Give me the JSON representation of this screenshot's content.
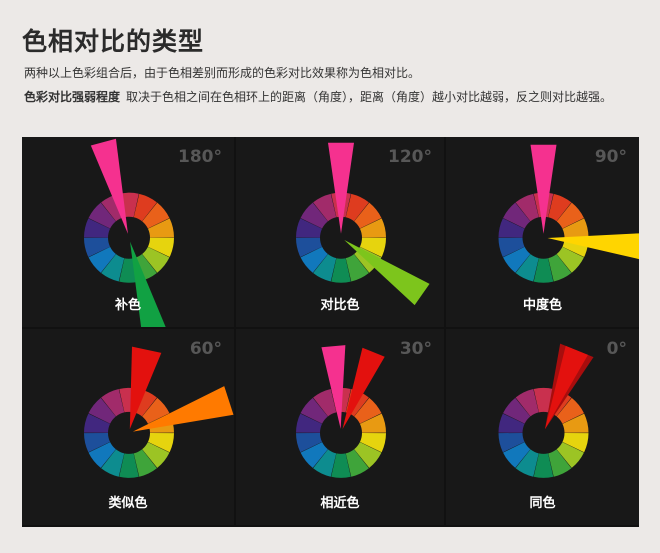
{
  "header": {
    "title": "色相对比的类型",
    "line1": "两种以上色彩组合后，由于色相差别而形成的色彩对比效果称为色相对比。",
    "line2_bold": "色彩对比强弱程度",
    "line2_rest": "取决于色相之间在色相环上的距离（角度），距离（角度）越小对比越弱，反之则对比越强。"
  },
  "colors": {
    "ring": [
      "#c9304e",
      "#de3c1f",
      "#e9611a",
      "#e89a12",
      "#e6d40e",
      "#9cc424",
      "#3fa43a",
      "#0f8c54",
      "#0d8c8f",
      "#1178bc",
      "#1d4f9b",
      "#41277f",
      "#71277a",
      "#a12b6a"
    ],
    "pointer_magenta": "#f5318f",
    "pointer_green": "#11a143",
    "pointer_lime": "#7dc51c",
    "pointer_yellow": "#ffd500",
    "pointer_red": "#e3110e",
    "pointer_orange": "#ff7a00",
    "pointer_crimson": "#f01b40",
    "pointer_darkred": "#a80d0d"
  },
  "panels": [
    {
      "degree": "180°",
      "label": "补色",
      "pointers": [
        {
          "angle": 345,
          "color": "pointer_magenta"
        },
        {
          "angle": 165,
          "color": "pointer_green"
        }
      ]
    },
    {
      "degree": "120°",
      "label": "对比色",
      "pointers": [
        {
          "angle": 0,
          "color": "pointer_magenta"
        },
        {
          "angle": 125,
          "color": "pointer_lime"
        }
      ]
    },
    {
      "degree": "90°",
      "label": "中度色",
      "pointers": [
        {
          "angle": 0,
          "color": "pointer_magenta"
        },
        {
          "angle": 95,
          "color": "pointer_yellow"
        }
      ]
    },
    {
      "degree": "60°",
      "label": "类似色",
      "pointers": [
        {
          "angle": 12,
          "color": "pointer_red"
        },
        {
          "angle": 72,
          "color": "pointer_orange"
        }
      ]
    },
    {
      "degree": "30°",
      "label": "相近色",
      "pointers": [
        {
          "angle": 355,
          "color": "pointer_magenta"
        },
        {
          "angle": 22,
          "color": "pointer_red"
        }
      ]
    },
    {
      "degree": "0°",
      "label": "同色",
      "pointers": [
        {
          "angle": 22,
          "color": "pointer_darkred"
        },
        {
          "angle": 22,
          "color": "pointer_red"
        }
      ]
    }
  ]
}
